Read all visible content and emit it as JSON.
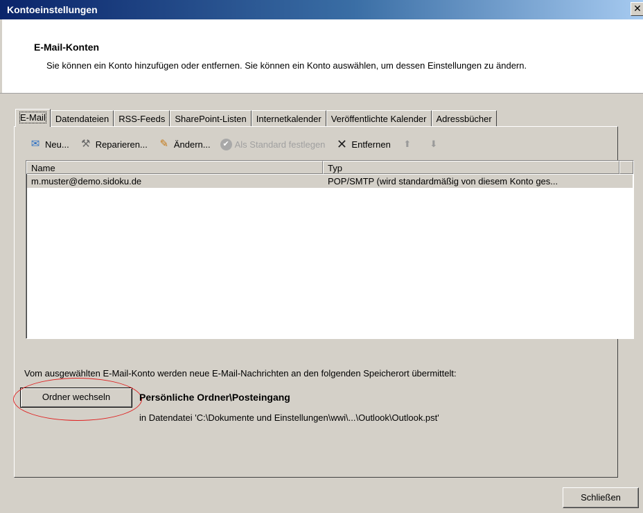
{
  "window": {
    "title": "Kontoeinstellungen",
    "close_glyph": "✕"
  },
  "header": {
    "title": "E-Mail-Konten",
    "description": "Sie können ein Konto hinzufügen oder entfernen. Sie können ein Konto auswählen, um dessen Einstellungen zu ändern."
  },
  "tabs": [
    "E-Mail",
    "Datendateien",
    "RSS-Feeds",
    "SharePoint-Listen",
    "Internetkalender",
    "Veröffentlichte Kalender",
    "Adressbücher"
  ],
  "toolbar": {
    "new": {
      "label": "Neu...",
      "icon": "new-account-icon"
    },
    "repair": {
      "label": "Reparieren...",
      "icon": "repair-tools-icon"
    },
    "change": {
      "label": "Ändern...",
      "icon": "change-icon"
    },
    "default": {
      "label": "Als Standard festlegen",
      "icon": "checkmark-icon"
    },
    "remove": {
      "label": "Entfernen",
      "icon": "x-icon"
    },
    "up_icon": "arrow-up-icon",
    "down_icon": "arrow-down-icon"
  },
  "list": {
    "columns": [
      "Name",
      "Typ"
    ],
    "rows": [
      {
        "name": "m.muster@demo.sidoku.de",
        "type": "POP/SMTP (wird standardmäßig von diesem Konto ges..."
      }
    ]
  },
  "delivery": {
    "info": "Vom ausgewählten E-Mail-Konto werden neue E-Mail-Nachrichten an den folgenden Speicherort übermittelt:",
    "change_folder": "Ordner wechseln",
    "folder": "Persönliche Ordner\\Posteingang",
    "data_file": "in Datendatei 'C:\\Dokumente und Einstellungen\\wwi\\...\\Outlook\\Outlook.pst'"
  },
  "footer": {
    "close": "Schließen"
  },
  "colors": {
    "dialog_bg": "#d4d0c8",
    "titlebar_start": "#0a246a",
    "highlight_ellipse": "#e02020"
  }
}
